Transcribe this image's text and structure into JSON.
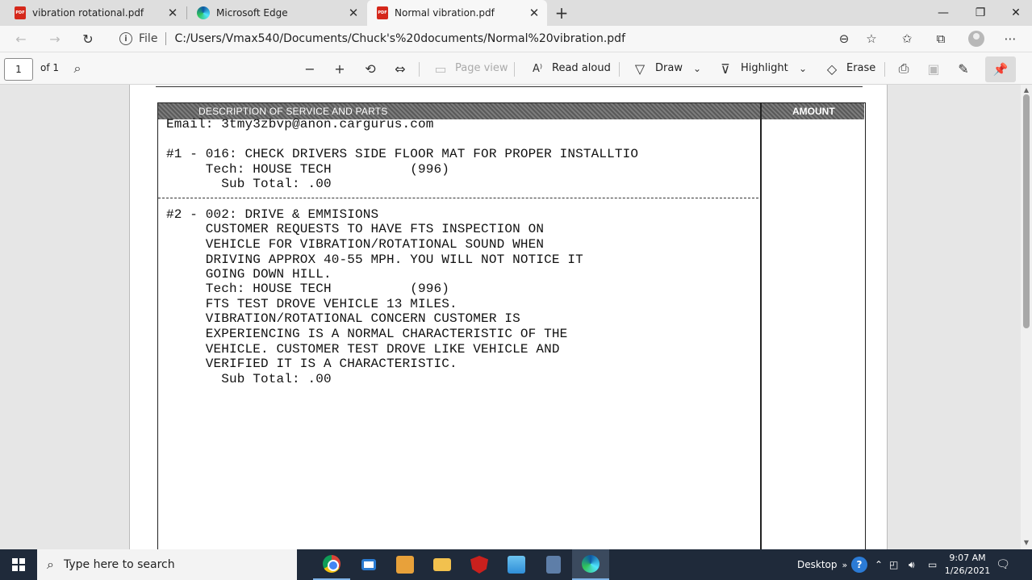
{
  "tabs": [
    {
      "title": "vibration rotational.pdf",
      "icon": "pdf-icon",
      "active": false
    },
    {
      "title": "Microsoft Edge",
      "icon": "edge-icon",
      "active": false
    },
    {
      "title": "Normal vibration.pdf",
      "icon": "pdf-icon",
      "active": true
    }
  ],
  "address": {
    "scheme_label": "File",
    "url": "C:/Users/Vmax540/Documents/Chuck's%20documents/Normal%20vibration.pdf"
  },
  "pdf_toolbar": {
    "page_number": "1",
    "page_count": "of 1",
    "page_view_label": "Page view",
    "read_aloud_label": "Read aloud",
    "draw_label": "Draw",
    "highlight_label": "Highlight",
    "erase_label": "Erase"
  },
  "document": {
    "header_description": "DESCRIPTION OF SERVICE AND PARTS",
    "header_amount": "AMOUNT",
    "lines": [
      "Email: 3tmy3zbvp@anon.cargurus.com",
      "#1 - 016: CHECK DRIVERS SIDE FLOOR MAT FOR PROPER INSTALLTIO",
      "     Tech: HOUSE TECH          (996)",
      "       Sub Total: .00",
      "#2 - 002: DRIVE & EMMISIONS",
      "     CUSTOMER REQUESTS TO HAVE FTS INSPECTION ON",
      "     VEHICLE FOR VIBRATION/ROTATIONAL SOUND WHEN",
      "     DRIVING APPROX 40-55 MPH. YOU WILL NOT NOTICE IT",
      "     GOING DOWN HILL.",
      "     Tech: HOUSE TECH          (996)",
      "     FTS TEST DROVE VEHICLE 13 MILES.",
      "     VIBRATION/ROTATIONAL CONCERN CUSTOMER IS",
      "     EXPERIENCING IS A NORMAL CHARACTERISTIC OF THE",
      "     VEHICLE. CUSTOMER TEST DROVE LIKE VEHICLE AND",
      "     VERIFIED IT IS A CHARACTERISTIC.",
      "       Sub Total: .00"
    ]
  },
  "taskbar": {
    "search_placeholder": "Type here to search",
    "desktop_label": "Desktop",
    "time": "9:07 AM",
    "date": "1/26/2021"
  }
}
